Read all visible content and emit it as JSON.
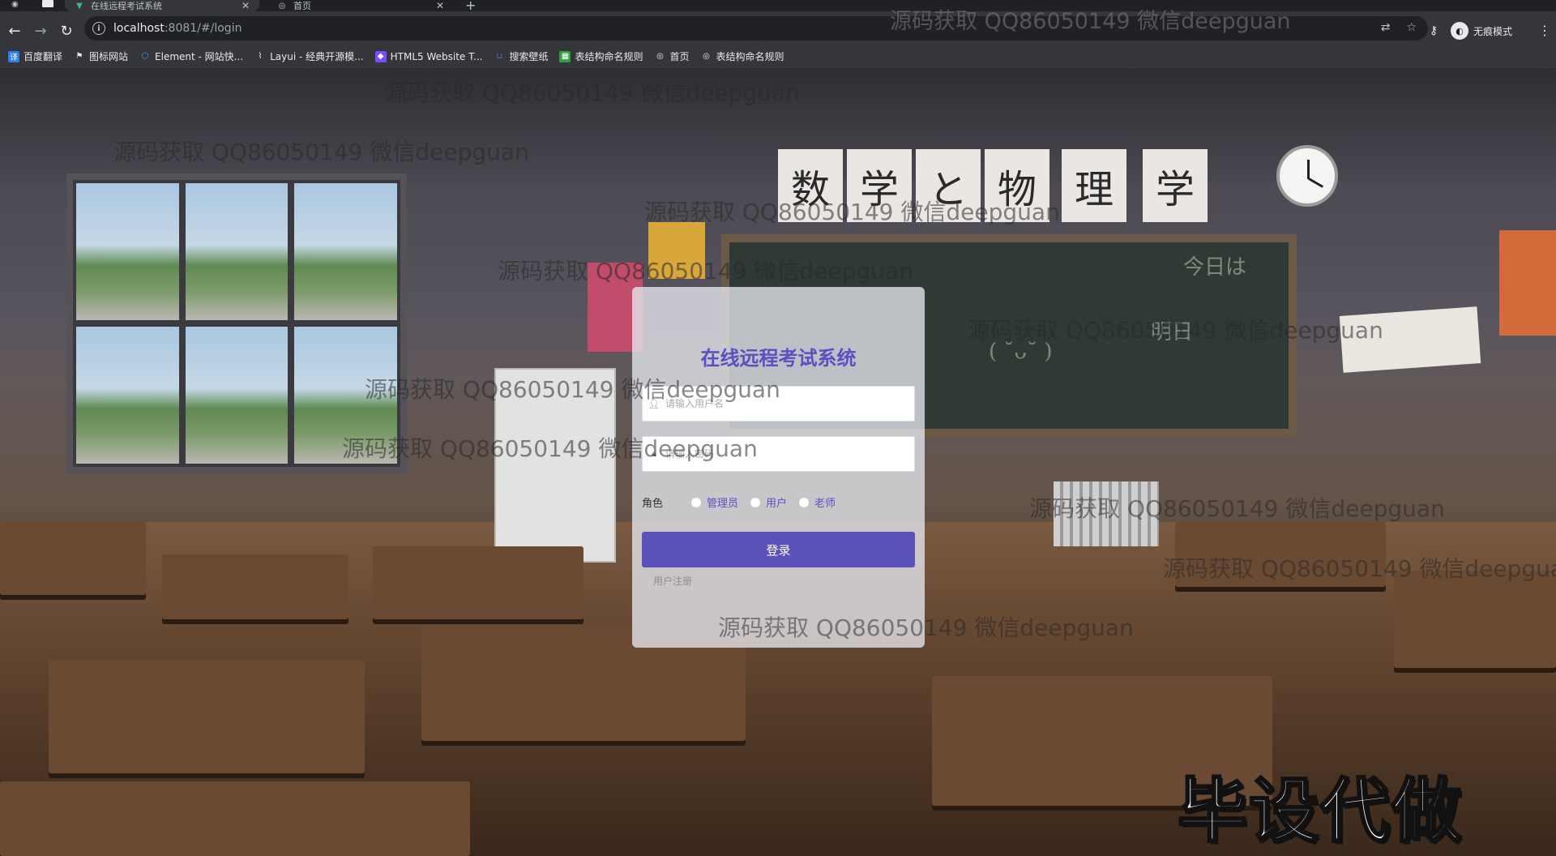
{
  "browser": {
    "tabs": [
      {
        "title": "在线远程考试系统",
        "active": true
      },
      {
        "title": "首页",
        "active": false
      }
    ],
    "url": {
      "host": "localhost",
      "rest": ":8081/#/login"
    },
    "incognito_label": "无痕模式",
    "bookmarks": [
      {
        "label": "百度翻译",
        "icon": "translate-icon",
        "color": "#2b7de9"
      },
      {
        "label": "图标网站",
        "icon": "flag-icon",
        "color": "#e8eaed"
      },
      {
        "label": "Element - 网站快...",
        "icon": "element-icon",
        "color": "#409eff"
      },
      {
        "label": "Layui - 经典开源模...",
        "icon": "layui-icon",
        "color": "#e8eaed"
      },
      {
        "label": "HTML5 Website T...",
        "icon": "html5-icon",
        "color": "#7c4dff"
      },
      {
        "label": "搜索壁纸",
        "icon": "wallpaper-icon",
        "color": "#5c6bc0"
      },
      {
        "label": "表结构命名规则",
        "icon": "table-icon",
        "color": "#2ea043"
      },
      {
        "label": "首页",
        "icon": "globe-icon",
        "color": "#e8eaed"
      },
      {
        "label": "表结构命名规则",
        "icon": "globe-icon",
        "color": "#e8eaed"
      }
    ]
  },
  "scene": {
    "banner_chars": [
      "数",
      "学",
      "と",
      "物",
      "理",
      "学"
    ]
  },
  "login": {
    "title": "在线远程考试系统",
    "username_placeholder": "请输入用户名",
    "password_placeholder": "请输入密码",
    "role_label": "角色",
    "roles": [
      "管理员",
      "用户",
      "老师"
    ],
    "submit_label": "登录",
    "register_label": "用户注册"
  },
  "watermarks": {
    "text": "源码获取 QQ86050149 微信deepguan",
    "stamp": "毕设代做"
  },
  "colors": {
    "accent": "#5c4fc4",
    "button": "#5a52b8"
  }
}
